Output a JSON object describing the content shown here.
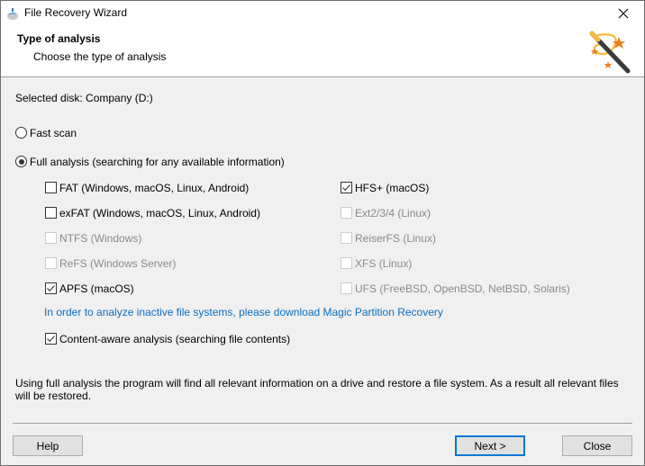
{
  "window": {
    "title": "File Recovery Wizard",
    "icons": {
      "app": "recovery-app-icon",
      "close": "close-icon",
      "header": "magic-wand-icon"
    }
  },
  "header": {
    "title": "Type of analysis",
    "subtitle": "Choose the type of analysis"
  },
  "content": {
    "selected_disk": "Selected disk: Company (D:)",
    "scan_modes": [
      {
        "label": "Fast scan",
        "selected": false
      },
      {
        "label": "Full analysis (searching for any available information)",
        "selected": true
      }
    ],
    "filesystems_left": [
      {
        "label": "FAT (Windows, macOS, Linux, Android)",
        "checked": false,
        "enabled": true
      },
      {
        "label": "exFAT (Windows, macOS, Linux, Android)",
        "checked": false,
        "enabled": true
      },
      {
        "label": "NTFS (Windows)",
        "checked": false,
        "enabled": false
      },
      {
        "label": "ReFS (Windows Server)",
        "checked": false,
        "enabled": false
      },
      {
        "label": "APFS (macOS)",
        "checked": true,
        "enabled": true
      }
    ],
    "filesystems_right": [
      {
        "label": "HFS+ (macOS)",
        "checked": true,
        "enabled": true
      },
      {
        "label": "Ext2/3/4 (Linux)",
        "checked": false,
        "enabled": false
      },
      {
        "label": "ReiserFS (Linux)",
        "checked": false,
        "enabled": false
      },
      {
        "label": "XFS (Linux)",
        "checked": false,
        "enabled": false
      },
      {
        "label": "UFS (FreeBSD, OpenBSD, NetBSD, Solaris)",
        "checked": false,
        "enabled": false
      }
    ],
    "download_link": "In order to analyze inactive file systems, please download Magic Partition Recovery",
    "content_aware": {
      "label": "Content-aware analysis (searching file contents)",
      "checked": true
    },
    "description": "Using full analysis the program will find all relevant information on a drive and restore a file system. As a result all relevant files will be restored."
  },
  "footer": {
    "help_label": "Help",
    "next_label": "Next >",
    "close_label": "Close"
  },
  "colors": {
    "link": "#0a6fc2",
    "default_button_border": "#0078d7",
    "background": "#f0f0f0"
  }
}
